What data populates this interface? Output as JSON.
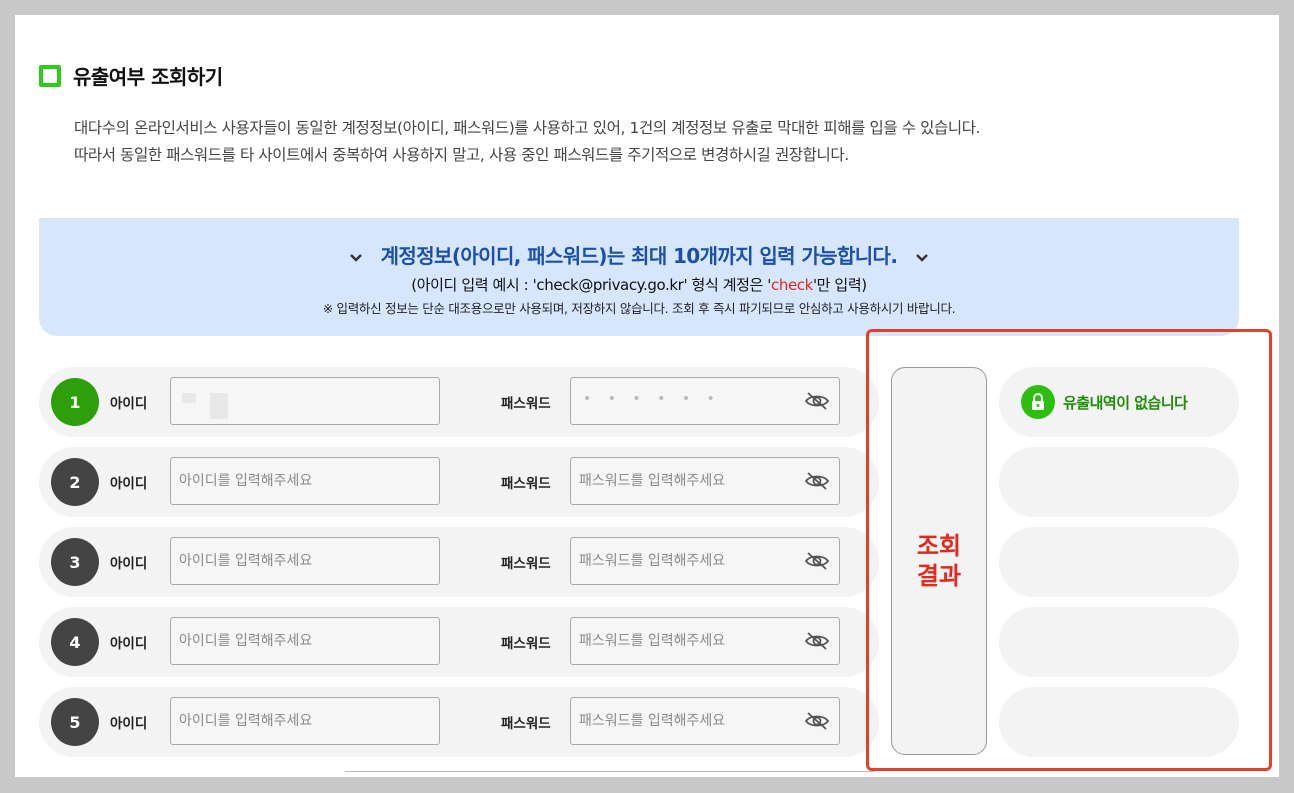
{
  "section": {
    "title": "유출여부 조회하기",
    "desc_line1": "대다수의 온라인서비스 사용자들이 동일한 계정정보(아이디, 패스워드)를 사용하고 있어, 1건의 계정정보 유출로 막대한 피해를 입을 수 있습니다.",
    "desc_line2": "따라서 동일한 패스워드를 타 사이트에서 중복하여 사용하지 말고, 사용 중인 패스워드를 주기적으로 변경하시길 권장합니다."
  },
  "banner": {
    "headline": "계정정보(아이디, 패스워드)는 최대 10개까지 입력 가능합니다.",
    "example_prefix": "(아이디 입력 예시 : 'check@privacy.go.kr' 형식 계정은 '",
    "example_highlight": "check",
    "example_suffix": "'만 입력)",
    "notice": "※ 입력하신 정보는 단순 대조용으로만 사용되며, 저장하지 않습니다. 조회 후 즉시 파기되므로 안심하고 사용하시기 바랍니다.",
    "chevron_icon": "chevron-down-icon"
  },
  "form": {
    "id_label": "아이디",
    "pw_label": "패스워드",
    "id_placeholder": "아이디를 입력해주세요",
    "pw_placeholder": "패스워드를 입력해주세요",
    "masked_password": "• • • • • •",
    "rows": [
      {
        "num": "1"
      },
      {
        "num": "2"
      },
      {
        "num": "3"
      },
      {
        "num": "4"
      },
      {
        "num": "5"
      }
    ]
  },
  "results": {
    "button_line1": "조회",
    "button_line2": "결과",
    "row1_text": "유출내역이 없습니다"
  },
  "colors": {
    "accent_green": "#2ecc1a",
    "banner_bg": "#d6e6fd",
    "banner_text": "#1c4fa6",
    "highlight_red": "#e02b1c"
  }
}
